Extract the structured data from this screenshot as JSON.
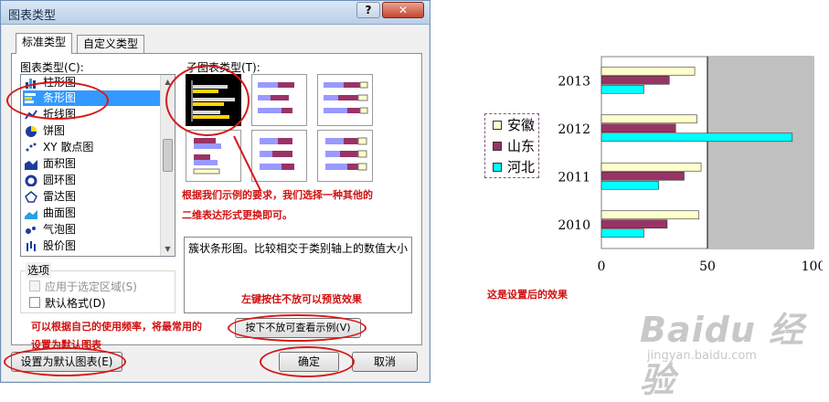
{
  "dialog": {
    "title": "图表类型",
    "help_label": "?",
    "close_label": "✕",
    "tabs": [
      {
        "label": "标准类型"
      },
      {
        "label": "自定义类型"
      }
    ],
    "chart_type_label": "图表类型(C):",
    "subtype_label": "子图表类型(T):",
    "chart_types": [
      {
        "label": "柱形图",
        "icon": "column-chart-icon",
        "selected": false
      },
      {
        "label": "条形图",
        "icon": "bar-chart-icon",
        "selected": true
      },
      {
        "label": "折线图",
        "icon": "line-chart-icon",
        "selected": false
      },
      {
        "label": "饼图",
        "icon": "pie-chart-icon",
        "selected": false
      },
      {
        "label": "XY 散点图",
        "icon": "scatter-chart-icon",
        "selected": false
      },
      {
        "label": "面积图",
        "icon": "area-chart-icon",
        "selected": false
      },
      {
        "label": "圆环图",
        "icon": "doughnut-chart-icon",
        "selected": false
      },
      {
        "label": "雷达图",
        "icon": "radar-chart-icon",
        "selected": false
      },
      {
        "label": "曲面图",
        "icon": "surface-chart-icon",
        "selected": false
      },
      {
        "label": "气泡图",
        "icon": "bubble-chart-icon",
        "selected": false
      },
      {
        "label": "股价图",
        "icon": "stock-chart-icon",
        "selected": false
      }
    ],
    "options_label": "选项",
    "option_apply_selection": "应用于选定区域(S)",
    "option_default_format": "默认格式(D)",
    "description": "簇状条形图。比较相交于类别轴上的数值大小",
    "preview_button": "按下不放可查看示例(V)",
    "set_default_button": "设置为默认图表(E)",
    "ok_button": "确定",
    "cancel_button": "取消"
  },
  "annotations": {
    "subtype_note_line1": "根据我们示例的要求，我们选择一种其他的",
    "subtype_note_line2": "二维表达形式更换即可。",
    "preview_note": "左键按住不放可以预览效果",
    "default_note_line1": "可以根据自己的使用频率，将最常用的",
    "default_note_line2": "设置为默认图表",
    "caption": "这是设置后的效果"
  },
  "colors": {
    "anhui": "#ffffcc",
    "shandong": "#993366",
    "hebei": "#00ffff",
    "plot_bg": "#c0c0c0",
    "annotation": "#d01010",
    "selection": "#3399ff"
  },
  "chart_data": {
    "type": "bar",
    "orientation": "horizontal",
    "categories": [
      "2010",
      "2011",
      "2012",
      "2013"
    ],
    "series": [
      {
        "name": "安徽",
        "values": [
          46,
          47,
          45,
          44
        ]
      },
      {
        "name": "山东",
        "values": [
          31,
          39,
          35,
          32
        ]
      },
      {
        "name": "河北",
        "values": [
          20,
          27,
          90,
          20
        ]
      }
    ],
    "x_ticks": [
      "0",
      "50",
      "100"
    ],
    "xlim": [
      0,
      100
    ],
    "legend_position": "left",
    "grid": true
  },
  "watermark": {
    "text": "Baidu 经验",
    "sub": "jingyan.baidu.com"
  }
}
